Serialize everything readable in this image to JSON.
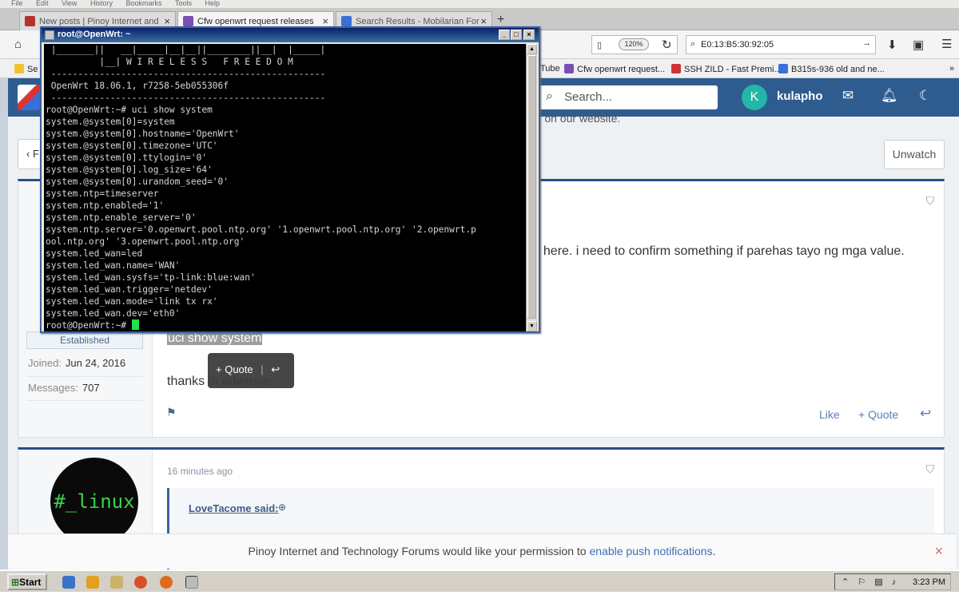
{
  "browser": {
    "menu": [
      "File",
      "Edit",
      "View",
      "History",
      "Bookmarks",
      "Tools",
      "Help"
    ],
    "tabs": [
      {
        "label": "New posts | Pinoy Internet and",
        "active": false
      },
      {
        "label": "Cfw openwrt request  releases",
        "active": true
      },
      {
        "label": "Search Results - Mobilarian For",
        "active": false
      }
    ],
    "new_tab": "+",
    "zoom": "120%",
    "search_value": "E0:13:B5:30:92:05",
    "bookmarks": [
      "Se",
      "Tube",
      "Cfw openwrt request...",
      "SSH ZILD - Fast Premi...",
      "B315s-936 old and ne...",
      "»"
    ],
    "colors": {
      "tab_active": "#f5f5f5",
      "bookmark_yt": "#d22",
      "bookmark_cfw": "#7a4fb5",
      "bookmark_ssh": "#c33",
      "bookmark_b315": "#3a6fd8"
    }
  },
  "forum": {
    "header_color": "#2f5c8f",
    "search_placeholder": "Search...",
    "user_initial": "K",
    "username": "kulapho",
    "notice_fragment": "er on our website.",
    "back_label": "F",
    "unwatch_label": "Unwatch",
    "post1": {
      "text_line": "ts here. i need to confirm something if parehas tayo ng mga value.",
      "selected_text": "uci show system",
      "thanks_text": "thanks in advance.",
      "user_badge": "Established",
      "joined_label": "Joined:",
      "joined_value": "Jun 24, 2016",
      "messages_label": "Messages:",
      "messages_value": "707",
      "quote_popup": "+ Quote",
      "like": "Like",
      "quote": "+ Quote"
    },
    "post2": {
      "avatar_text": "#_linux",
      "time": "16 minutes ago",
      "quote_author": "LoveTacome said:"
    },
    "push_text": "Pinoy Internet and Technology Forums would like your permission to ",
    "push_link": "enable push notifications",
    "push_end": "."
  },
  "putty": {
    "title": "root@OpenWrt: ~",
    "lines": [
      " |_______||   __|_____|__|__||________||__|  |_____|",
      "          |__| W I R E L E S S   F R E E D O M",
      " ---------------------------------------------------",
      " OpenWrt 18.06.1, r7258-5eb055306f",
      " ---------------------------------------------------",
      "root@OpenWrt:~# uci show system",
      "system.@system[0]=system",
      "system.@system[0].hostname='OpenWrt'",
      "system.@system[0].timezone='UTC'",
      "system.@system[0].ttylogin='0'",
      "system.@system[0].log_size='64'",
      "system.@system[0].urandom_seed='0'",
      "system.ntp=timeserver",
      "system.ntp.enabled='1'",
      "system.ntp.enable_server='0'",
      "system.ntp.server='0.openwrt.pool.ntp.org' '1.openwrt.pool.ntp.org' '2.openwrt.p",
      "ool.ntp.org' '3.openwrt.pool.ntp.org'",
      "system.led_wan=led",
      "system.led_wan.name='WAN'",
      "system.led_wan.sysfs='tp-link:blue:wan'",
      "system.led_wan.trigger='netdev'",
      "system.led_wan.mode='link tx rx'",
      "system.led_wan.dev='eth0'"
    ],
    "prompt": "root@OpenWrt:~# ",
    "cursor_color": "#22e04a"
  },
  "taskbar": {
    "start": "Start",
    "clock": "3:23 PM"
  }
}
